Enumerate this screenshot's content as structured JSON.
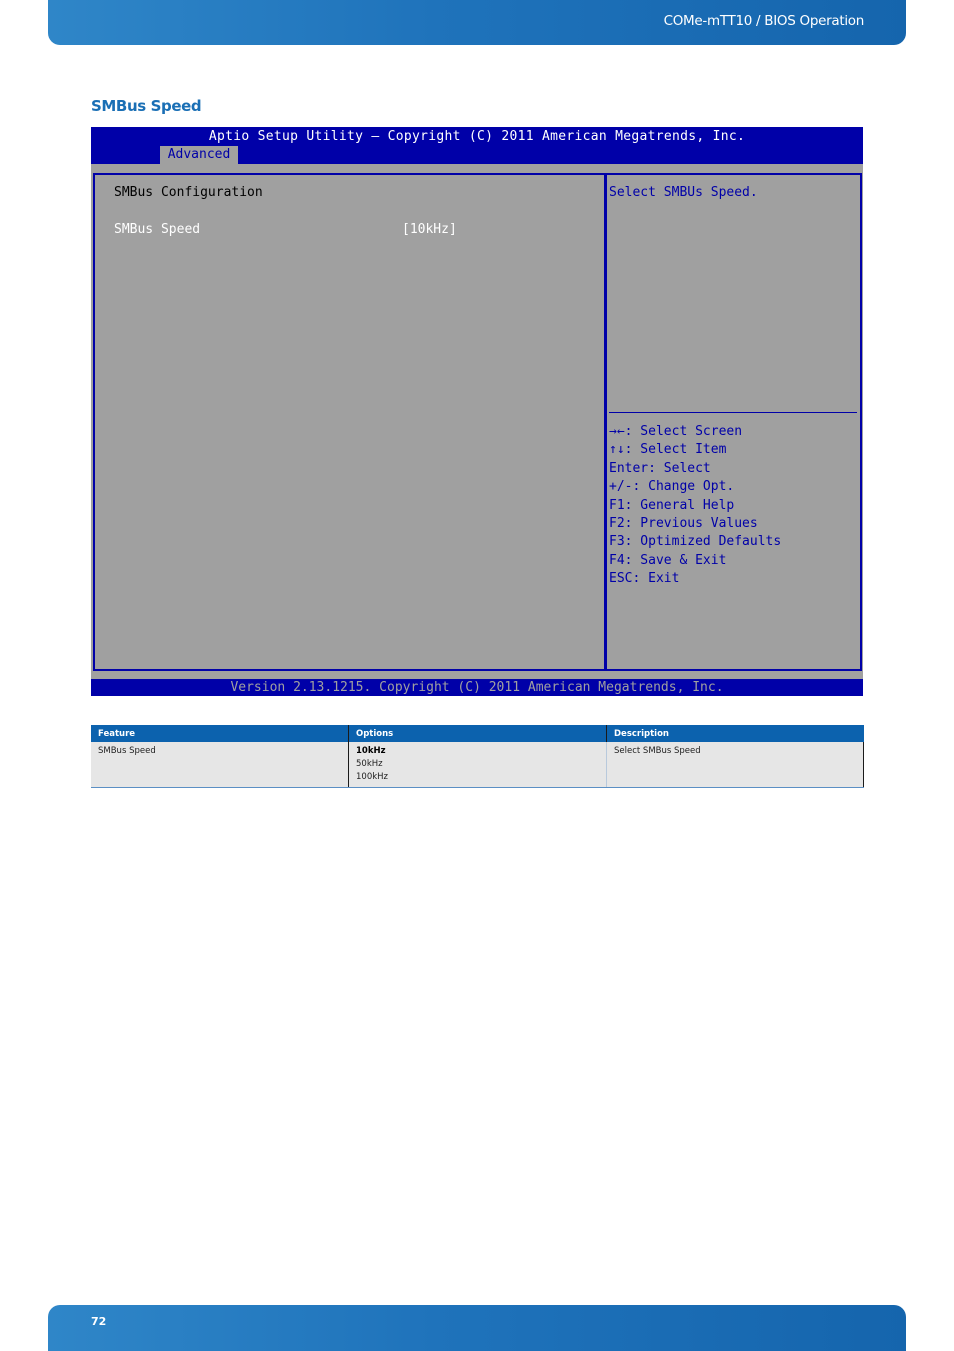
{
  "header": {
    "doc_title": "COMe-mTT10 / BIOS Operation"
  },
  "section": {
    "title": "SMBus Speed"
  },
  "bios": {
    "title": "Aptio Setup Utility – Copyright (C) 2011 American Megatrends, Inc.",
    "active_tab": "Advanced",
    "menu_heading": "SMBus Configuration",
    "items": [
      {
        "label": "SMBus Speed",
        "value": "[10kHz]"
      }
    ],
    "help_text": "Select SMBUs Speed.",
    "keys": [
      "→←: Select Screen",
      "↑↓: Select Item",
      "Enter: Select",
      "+/-: Change Opt.",
      "F1: General Help",
      "F2: Previous Values",
      "F3: Optimized Defaults",
      "F4: Save & Exit",
      "ESC: Exit"
    ],
    "footer": "Version 2.13.1215. Copyright (C) 2011 American Megatrends, Inc.",
    "colors": {
      "bar_blue": "#0000a8",
      "panel_gray": "#a0a0a0"
    }
  },
  "table": {
    "headers": [
      "Feature",
      "Options",
      "Description"
    ],
    "rows": [
      {
        "feature": "SMBus Speed",
        "options": [
          "10kHz",
          "50kHz",
          "100kHz"
        ],
        "default_option": "10kHz",
        "description": "Select SMBus Speed"
      }
    ]
  },
  "footer": {
    "page_number": "72"
  }
}
